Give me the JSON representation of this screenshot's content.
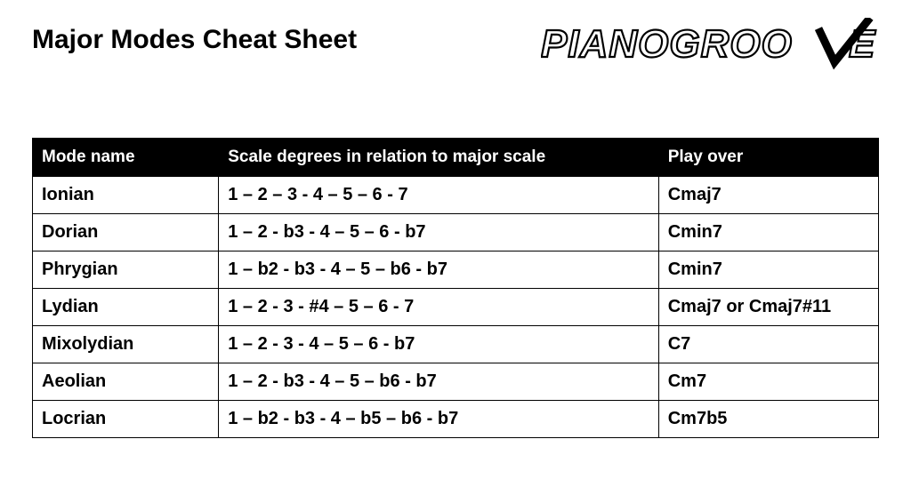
{
  "title": "Major Modes Cheat Sheet",
  "brand": "PIANOGROOVE",
  "columns": {
    "mode": "Mode name",
    "degrees": "Scale degrees in relation to major scale",
    "playover": "Play over"
  },
  "rows": [
    {
      "mode": "Ionian",
      "degrees": "1 – 2 – 3 - 4 – 5 – 6 - 7",
      "playover": "Cmaj7"
    },
    {
      "mode": "Dorian",
      "degrees": "1 – 2 - b3 - 4 – 5 – 6 - b7",
      "playover": "Cmin7"
    },
    {
      "mode": "Phrygian",
      "degrees": "1 – b2 - b3 - 4 – 5 – b6 - b7",
      "playover": "Cmin7"
    },
    {
      "mode": "Lydian",
      "degrees": "1 – 2 - 3 - #4 – 5 – 6 - 7",
      "playover": "Cmaj7  or  Cmaj7#11"
    },
    {
      "mode": "Mixolydian",
      "degrees": "1 – 2 - 3 - 4 – 5 – 6 - b7",
      "playover": "C7"
    },
    {
      "mode": "Aeolian",
      "degrees": "1 – 2 - b3 - 4 – 5 – b6 - b7",
      "playover": "Cm7"
    },
    {
      "mode": "Locrian",
      "degrees": "1 – b2 - b3 - 4 – b5 – b6 - b7",
      "playover": "Cm7b5"
    }
  ]
}
